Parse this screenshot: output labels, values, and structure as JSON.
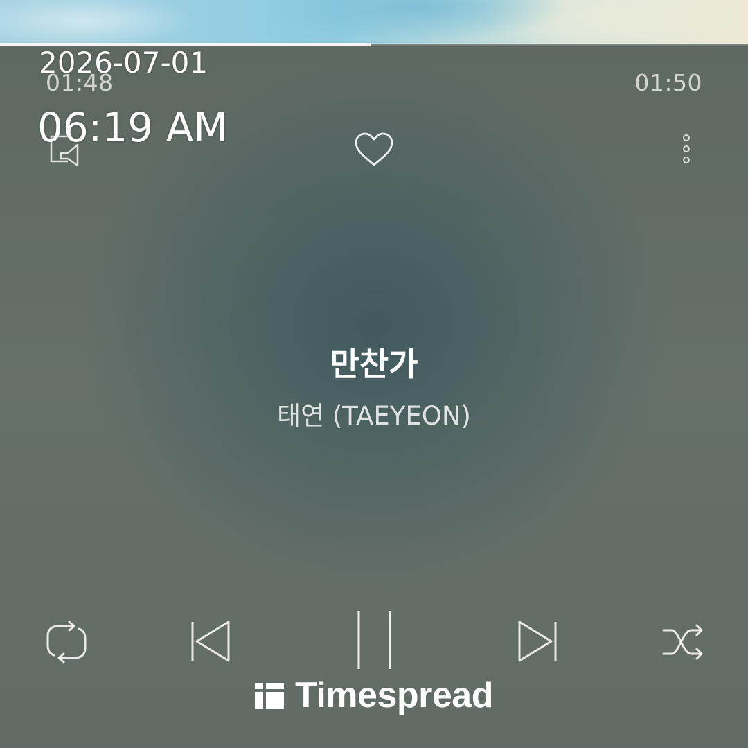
{
  "player": {
    "progress_fraction": 0.495,
    "elapsed_time": "01:48",
    "total_time": "01:50",
    "track_title": "만찬가",
    "artist": "태연 (TAEYEON)",
    "is_favorite": false,
    "is_playing": true
  },
  "top_controls": {
    "left_icon": "cast-device-icon",
    "center_icon": "heart-icon",
    "right_icon": "more-vertical-icon"
  },
  "bottom_controls": {
    "icons": [
      "repeat-icon",
      "previous-icon",
      "pause-icon",
      "next-icon",
      "shuffle-icon"
    ]
  },
  "overlay": {
    "date": "2026-07-01",
    "time": "06:19 AM"
  },
  "watermark": {
    "text": "Timespread"
  },
  "colors": {
    "background": "#5f6a64",
    "progress_fill": "#f4f4f2",
    "text": "#ffffff"
  }
}
